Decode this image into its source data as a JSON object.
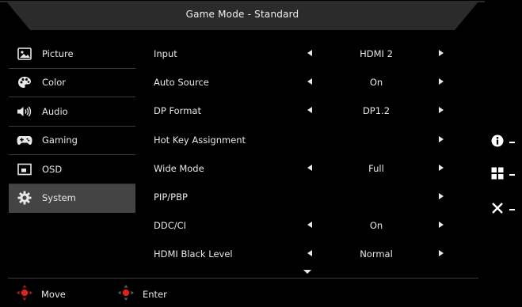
{
  "title": "Game Mode - Standard",
  "sidebar": {
    "items": [
      {
        "label": "Picture",
        "icon": "picture-icon",
        "active": false
      },
      {
        "label": "Color",
        "icon": "palette-icon",
        "active": false
      },
      {
        "label": "Audio",
        "icon": "speaker-icon",
        "active": false
      },
      {
        "label": "Gaming",
        "icon": "gamepad-icon",
        "active": false
      },
      {
        "label": "OSD",
        "icon": "osd-icon",
        "active": false
      },
      {
        "label": "System",
        "icon": "gear-icon",
        "active": true
      }
    ]
  },
  "settings": {
    "rows": [
      {
        "label": "Input",
        "value": "HDMI 2",
        "left_arrow": true
      },
      {
        "label": "Auto Source",
        "value": "On",
        "left_arrow": true
      },
      {
        "label": "DP Format",
        "value": "DP1.2",
        "left_arrow": true
      },
      {
        "label": "Hot Key Assignment",
        "value": "",
        "left_arrow": false
      },
      {
        "label": "Wide Mode",
        "value": "Full",
        "left_arrow": true
      },
      {
        "label": "PIP/PBP",
        "value": "",
        "left_arrow": false
      },
      {
        "label": "DDC/CI",
        "value": "On",
        "left_arrow": true
      },
      {
        "label": "HDMI Black Level",
        "value": "Normal",
        "left_arrow": true
      }
    ]
  },
  "footer": {
    "move_label": "Move",
    "enter_label": "Enter"
  },
  "hotkeys": [
    {
      "icon": "info-icon"
    },
    {
      "icon": "menu-grid-icon"
    },
    {
      "icon": "close-icon"
    }
  ],
  "colors": {
    "background": "#000000",
    "active_item": "#444444",
    "divider": "#3a3a3a",
    "nav_accent": "#e0201b"
  }
}
